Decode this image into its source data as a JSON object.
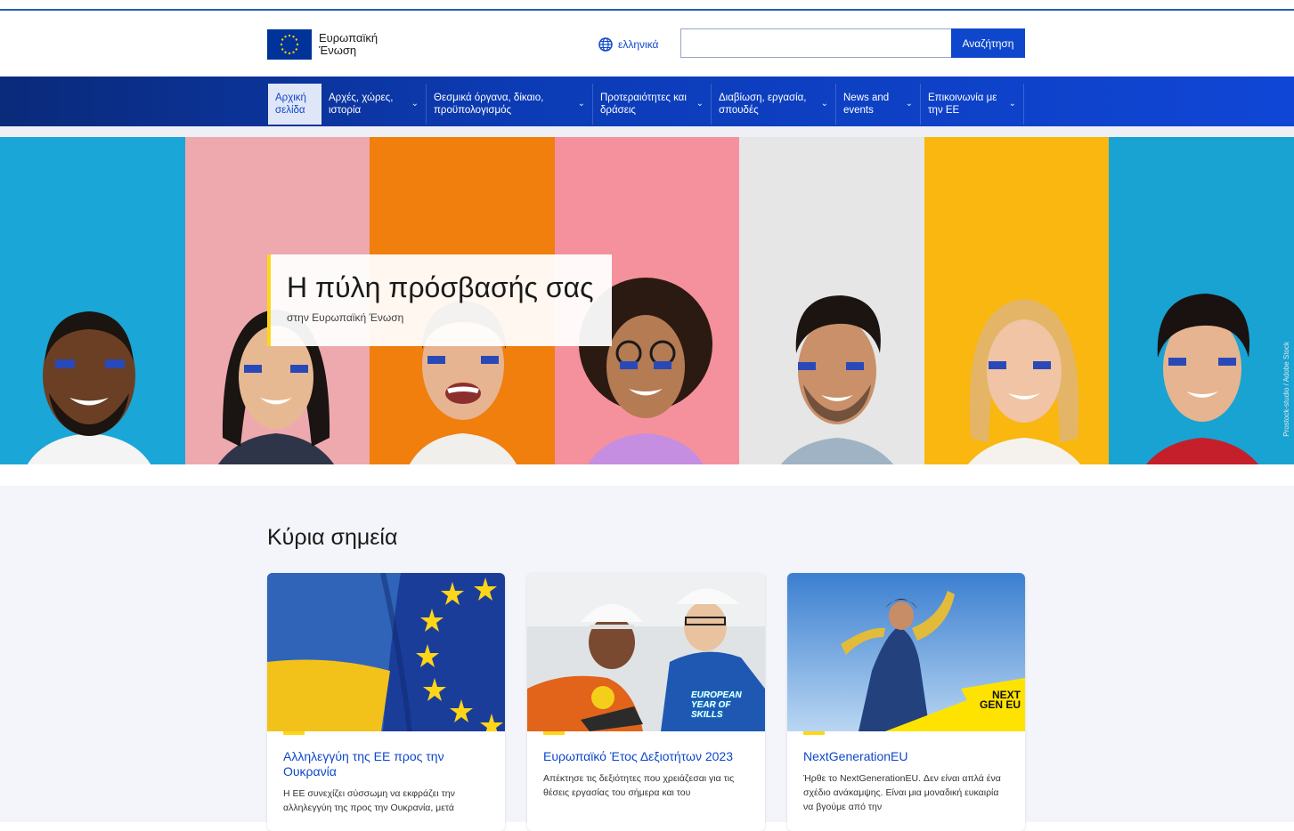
{
  "header": {
    "logo_text": "Ευρωπαϊκή Ένωση",
    "language": "ελληνικά",
    "search": {
      "value": "",
      "placeholder": ""
    },
    "search_button": "Αναζήτηση"
  },
  "nav": {
    "items": [
      {
        "label": "Αρχική σελίδα",
        "active": true,
        "has_menu": false
      },
      {
        "label": "Αρχές, χώρες, ιστορία",
        "active": false,
        "has_menu": true
      },
      {
        "label": "Θεσμικά όργανα, δίκαιο, προϋπολογισμός",
        "active": false,
        "has_menu": true
      },
      {
        "label": "Προτεραιότητες και δράσεις",
        "active": false,
        "has_menu": true
      },
      {
        "label": "Διαβίωση, εργασία, σπουδές",
        "active": false,
        "has_menu": true
      },
      {
        "label": "News and events",
        "active": false,
        "has_menu": true
      },
      {
        "label": "Επικοινωνία με την ΕΕ",
        "active": false,
        "has_menu": true
      }
    ]
  },
  "hero": {
    "title": "Η πύλη πρόσβασής σας",
    "subtitle": "στην Ευρωπαϊκή Ένωση",
    "credit": "Prostock-studio / Adobe Stock",
    "stripe_colors": [
      "#1aa6d6",
      "#eea9ae",
      "#f07f0d",
      "#f5919c",
      "#e6e6e6",
      "#f9b70f",
      "#18a3d2"
    ]
  },
  "highlights": {
    "title": "Κύρια σημεία",
    "cards": [
      {
        "title": "Αλληλεγγύη της ΕΕ προς την Ουκρανία",
        "desc": "Η ΕΕ συνεχίζει σύσσωμη να εκφράζει την αλληλεγγύη της προς την Ουκρανία, μετά"
      },
      {
        "title": "Ευρωπαϊκό Έτος Δεξιοτήτων 2023",
        "desc": "Απέκτησε τις δεξιότητες που χρειάζεσαι για τις θέσεις εργασίας του σήμερα και του",
        "badge": "EUROPEAN YEAR OF SKILLS"
      },
      {
        "title": "NextGenerationEU",
        "desc": "Ήρθε το NextGenerationEU. Δεν είναι απλά ένα σχέδιο ανάκαμψης. Είναι μια μοναδική ευκαιρία να βγούμε από την",
        "badge": "NEXT GEN EU"
      }
    ]
  },
  "colors": {
    "primary": "#0e47cb",
    "nav_dark": "#0a2a7a",
    "accent": "#ffd617",
    "flag_blue": "#003399"
  },
  "icons": {
    "language": "globe-icon",
    "flag": "eu-flag-icon",
    "dropdown": "chevron-down-icon"
  }
}
